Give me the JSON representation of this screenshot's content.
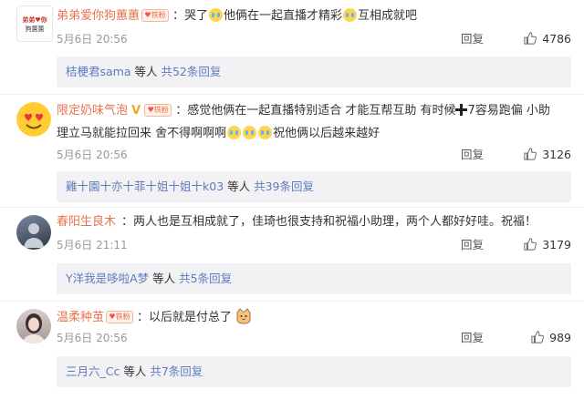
{
  "comments": [
    {
      "username": "弟弟爱你狗蕙蕙",
      "badge": "铁粉",
      "avatar_text": [
        "弟弟♥你",
        "狗蕙蕙"
      ],
      "text_parts": [
        "：哭了",
        "他俩在一起直播才精彩",
        "互相成就吧"
      ],
      "emoji": [
        "crying-face-icon",
        "crying-face-icon"
      ],
      "time": "5月6日 20:56",
      "reply_label": "回复",
      "likes": "4786",
      "subreply_user": "桔梗君sama",
      "subreply_mid": " 等人 ",
      "subreply_count": "共52条回复"
    },
    {
      "username": "限定奶味气泡",
      "badge": "铁粉",
      "vip": "V",
      "text_line1_parts": [
        "：感觉他俩在一起直播特别适合 才能互帮互助 有时候",
        "7容易跑偏 小助"
      ],
      "text_line2_parts": [
        "理立马就能拉回来 舍不得啊啊啊",
        "祝他俩以后越来越好"
      ],
      "time": "5月6日 20:56",
      "reply_label": "回复",
      "likes": "3126",
      "subreply_user": "雞十園十亦十菲十姐十姐十k03",
      "subreply_mid": " 等人 ",
      "subreply_count": "共39条回复"
    },
    {
      "username": "春阳生良木",
      "text": "：两人也是互相成就了，佳琦也很支持和祝福小助理，两个人都好好哇。祝福！",
      "time": "5月6日 21:11",
      "reply_label": "回复",
      "likes": "3179",
      "subreply_user": "Y洋我是哆啦A梦",
      "subreply_mid": " 等人 ",
      "subreply_count": "共5条回复"
    },
    {
      "username": "温柔种茧",
      "badge": "铁粉",
      "text": "：以后就是付总了",
      "time": "5月6日 20:56",
      "reply_label": "回复",
      "likes": "989",
      "subreply_user": "三月六_Cc",
      "subreply_mid": " 等人 ",
      "subreply_count": "共7条回复"
    }
  ],
  "colors": {
    "username": "#eb7350",
    "link": "#5f7bbd",
    "meta": "#999999",
    "subbox_bg": "#f2f2f5"
  }
}
